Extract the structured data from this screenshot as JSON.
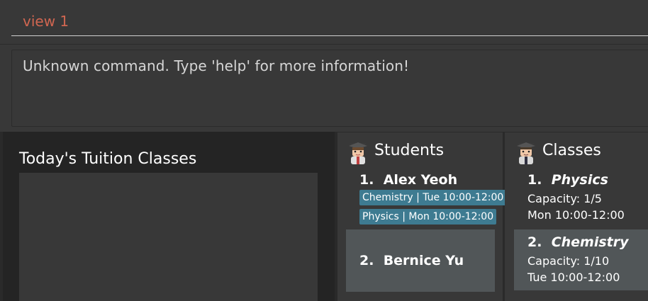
{
  "command": {
    "value": "view 1"
  },
  "result": {
    "message": "Unknown command. Type 'help' for more information!"
  },
  "today": {
    "title": "Today's Tuition Classes"
  },
  "students": {
    "title": "Students",
    "icon": "student-avatar-icon",
    "items": [
      {
        "index": "1.",
        "name": "Alex Yeoh",
        "classes": [
          "Chemistry | Tue 10:00-12:00",
          "Physics | Mon 10:00-12:00"
        ]
      },
      {
        "index": "2.",
        "name": "Bernice Yu",
        "classes": []
      }
    ]
  },
  "classes": {
    "title": "Classes",
    "icon": "teacher-avatar-icon",
    "items": [
      {
        "index": "1.",
        "subject": "Physics",
        "capacity": "Capacity: 1/5",
        "time": "Mon 10:00-12:00"
      },
      {
        "index": "2.",
        "subject": "Chemistry",
        "capacity": "Capacity: 1/10",
        "time": "Tue 10:00-12:00"
      }
    ]
  },
  "colors": {
    "command_text": "#d06651",
    "tag_bg": "#3e7b91",
    "selected_card_bg": "#515658"
  }
}
